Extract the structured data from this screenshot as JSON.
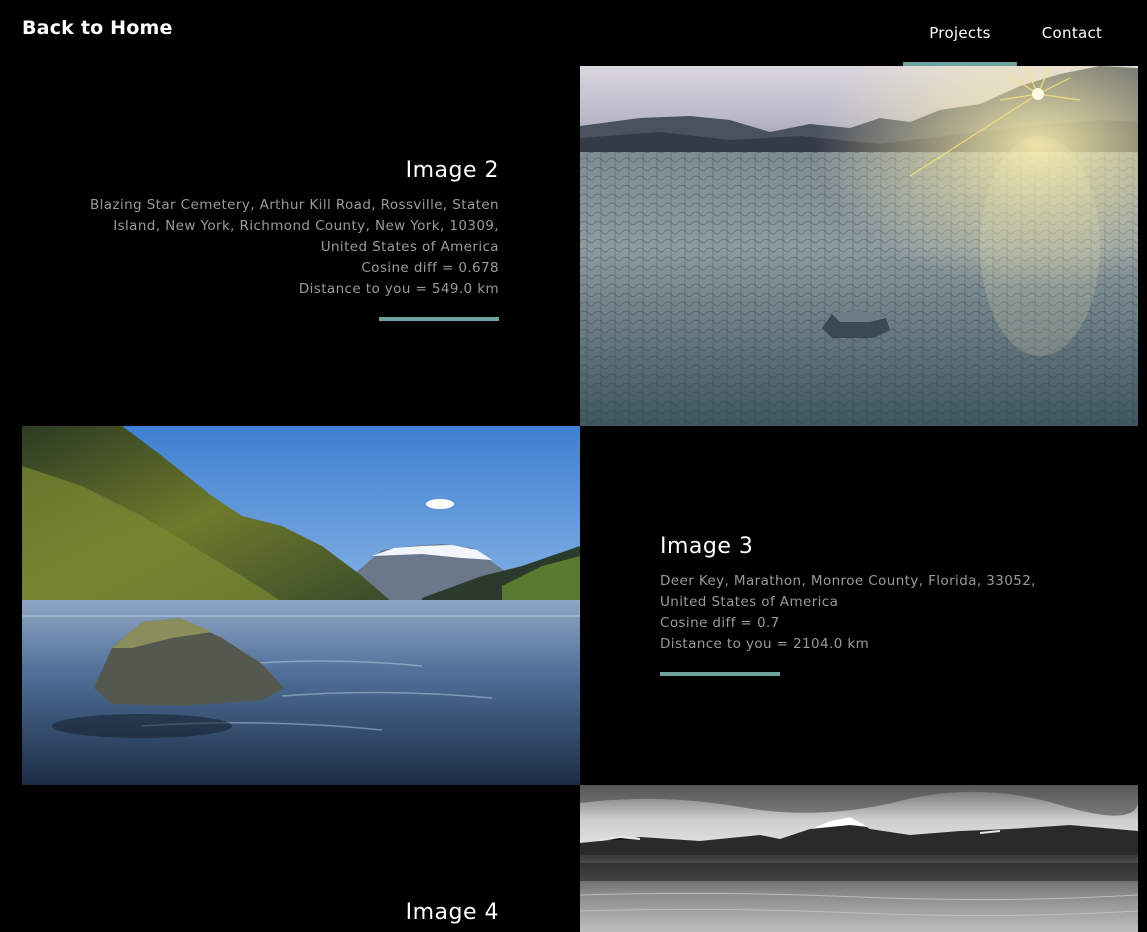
{
  "header": {
    "home_label": "Back to Home",
    "nav": {
      "projects": "Projects",
      "contact": "Contact"
    },
    "accent_color": "#6fa3a0"
  },
  "items": [
    {
      "title": "Image 2",
      "address": "Blazing Star Cemetery, Arthur Kill Road, Rossville, Staten Island, New York, Richmond County, New York, 10309, United States of America",
      "cosine": "Cosine diff = 0.678",
      "distance": "Distance to you = 549.0 km",
      "photo": "desert-playa-sunset-rock"
    },
    {
      "title": "Image 3",
      "address": "Deer Key, Marathon, Monroe County, Florida, 33052, United States of America",
      "cosine": "Cosine diff = 0.7",
      "distance": "Distance to you = 2104.0 km",
      "photo": "fjord-river-boulder"
    },
    {
      "title": "Image 4",
      "photo": "monochrome-mountain-lake"
    }
  ]
}
